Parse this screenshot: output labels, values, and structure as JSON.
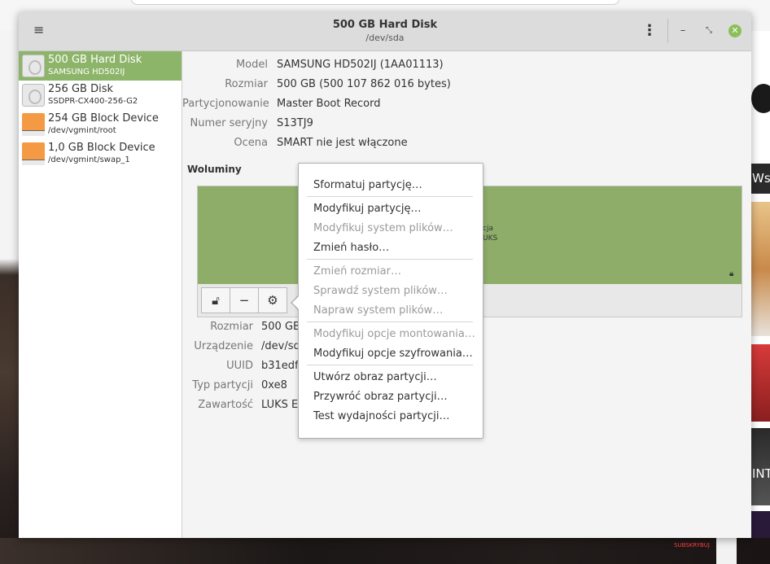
{
  "window": {
    "title": "500 GB Hard Disk",
    "subtitle": "/dev/sda",
    "menu_icon": "hamburger-icon",
    "kebab_icon": "vertical-dots-icon",
    "minimize_glyph": "–",
    "restore_glyph": "⤡",
    "close_glyph": "✕"
  },
  "sidebar": {
    "items": [
      {
        "name": "500 GB Hard Disk",
        "sub": "SAMSUNG HD502IJ",
        "icon": "hard-disk-icon",
        "selected": true
      },
      {
        "name": "256 GB Disk",
        "sub": "SSDPR-CX400-256-G2",
        "icon": "hard-disk-icon",
        "selected": false
      },
      {
        "name": "254 GB Block Device",
        "sub": "/dev/vgmint/root",
        "icon": "block-device-icon",
        "selected": false
      },
      {
        "name": "1,0 GB Block Device",
        "sub": "/dev/vgmint/swap_1",
        "icon": "block-device-icon",
        "selected": false
      }
    ]
  },
  "drive": {
    "model_label": "Model",
    "model": "SAMSUNG HD502IJ (1AA01113)",
    "size_label": "Rozmiar",
    "size": "500 GB (500 107 862 016 bytes)",
    "partitioning_label": "Partycjonowanie",
    "partitioning": "Master Boot Record",
    "serial_label": "Numer seryjny",
    "serial": "S13TJ9",
    "assessment_label": "Ocena",
    "assessment": "SMART nie jest włączone"
  },
  "volumes": {
    "heading": "Woluminy",
    "partition_text_1": "cja",
    "partition_text_2": "UKS",
    "lock_icon": "lock-icon"
  },
  "volume_toolbar": {
    "unlock_icon": "unlock-icon",
    "remove_icon": "minus-icon",
    "settings_icon": "gears-icon"
  },
  "partition": {
    "size_label": "Rozmiar",
    "size": "500 GB",
    "device_label": "Urządzenie",
    "device": "/dev/sd",
    "uuid_label": "UUID",
    "uuid": "b31edf",
    "type_label": "Typ partycji",
    "type": "0xe8",
    "contents_label": "Zawartość",
    "contents": "LUKS En"
  },
  "menu": {
    "format": "Sformatuj partycję…",
    "edit_partition": "Modyfikuj partycję…",
    "edit_filesystem": "Modyfikuj system plików…",
    "change_passphrase": "Zmień hasło…",
    "resize": "Zmień rozmiar…",
    "check_fs": "Sprawdź system plików…",
    "repair_fs": "Napraw system plików…",
    "edit_mount": "Modyfikuj opcje montowania…",
    "edit_encryption": "Modyfikuj opcje szyfrowania…",
    "create_image": "Utwórz obraz partycji…",
    "restore_image": "Przywróć obraz partycji…",
    "benchmark": "Test wydajności partycji…"
  },
  "background": {
    "right_text_1": "Wszy",
    "right_text_2": "INT",
    "subscribe": "SUBSKRYBUJ"
  }
}
